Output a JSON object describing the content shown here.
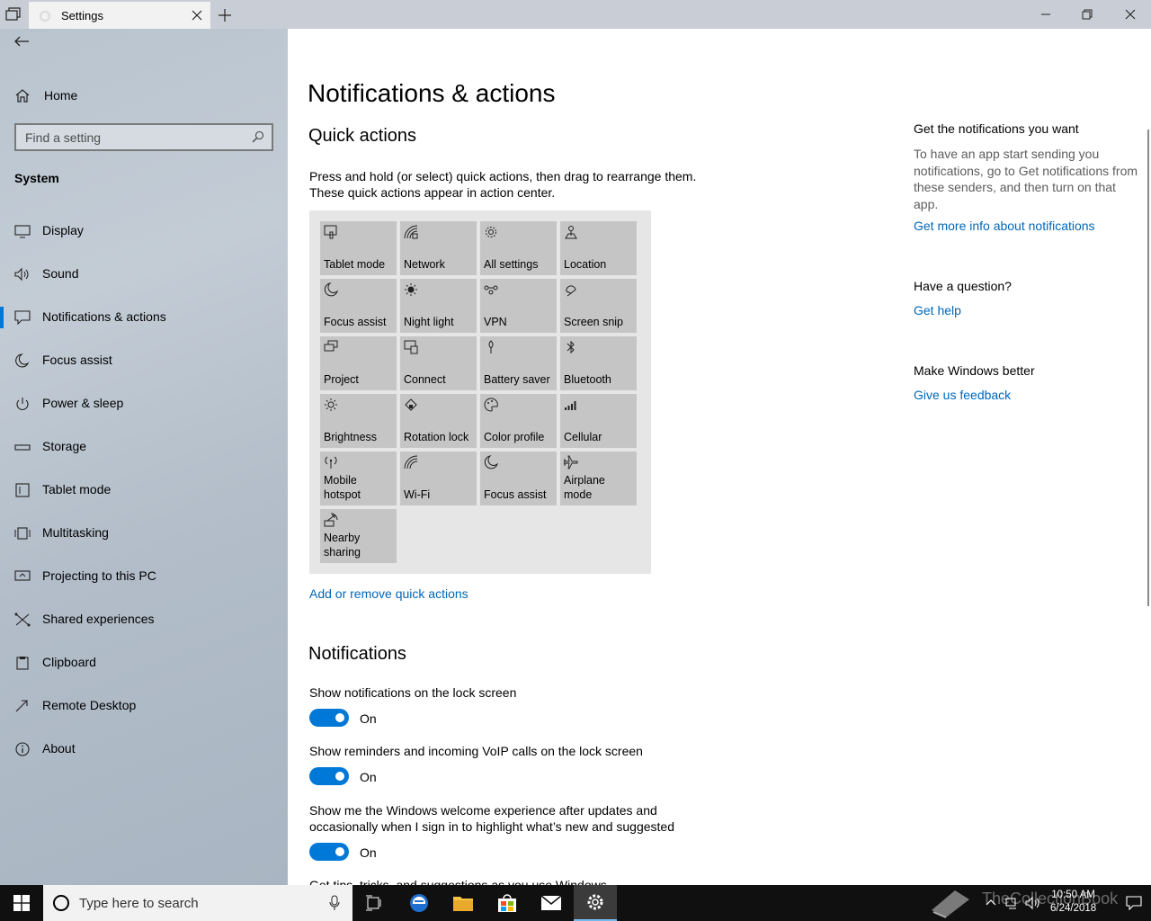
{
  "window": {
    "tab_title": "Settings"
  },
  "sidebar": {
    "home_label": "Home",
    "search_placeholder": "Find a setting",
    "section": "System",
    "items": [
      {
        "label": "Display",
        "icon": "display-icon"
      },
      {
        "label": "Sound",
        "icon": "sound-icon"
      },
      {
        "label": "Notifications & actions",
        "icon": "notification-icon",
        "selected": true
      },
      {
        "label": "Focus assist",
        "icon": "moon-icon"
      },
      {
        "label": "Power & sleep",
        "icon": "power-icon"
      },
      {
        "label": "Storage",
        "icon": "storage-icon"
      },
      {
        "label": "Tablet mode",
        "icon": "tablet-icon"
      },
      {
        "label": "Multitasking",
        "icon": "multitasking-icon"
      },
      {
        "label": "Projecting to this PC",
        "icon": "projecting-icon"
      },
      {
        "label": "Shared experiences",
        "icon": "shared-icon"
      },
      {
        "label": "Clipboard",
        "icon": "clipboard-icon"
      },
      {
        "label": "Remote Desktop",
        "icon": "remote-desktop-icon"
      },
      {
        "label": "About",
        "icon": "info-icon"
      }
    ]
  },
  "main": {
    "title": "Notifications & actions",
    "quick_actions": {
      "heading": "Quick actions",
      "description": "Press and hold (or select) quick actions, then drag to rearrange them. These quick actions appear in action center.",
      "tiles": [
        {
          "label": "Tablet mode",
          "icon": "tablet-mode-icon"
        },
        {
          "label": "Network",
          "icon": "network-icon"
        },
        {
          "label": "All settings",
          "icon": "gear-icon"
        },
        {
          "label": "Location",
          "icon": "location-icon"
        },
        {
          "label": "Focus assist",
          "icon": "moon-icon"
        },
        {
          "label": "Night light",
          "icon": "night-light-icon"
        },
        {
          "label": "VPN",
          "icon": "vpn-icon"
        },
        {
          "label": "Screen snip",
          "icon": "screen-snip-icon"
        },
        {
          "label": "Project",
          "icon": "project-icon"
        },
        {
          "label": "Connect",
          "icon": "connect-icon"
        },
        {
          "label": "Battery saver",
          "icon": "battery-saver-icon"
        },
        {
          "label": "Bluetooth",
          "icon": "bluetooth-icon"
        },
        {
          "label": "Brightness",
          "icon": "brightness-icon"
        },
        {
          "label": "Rotation lock",
          "icon": "rotation-lock-icon"
        },
        {
          "label": "Color profile",
          "icon": "color-profile-icon"
        },
        {
          "label": "Cellular",
          "icon": "cellular-icon"
        },
        {
          "label": "Mobile hotspot",
          "icon": "mobile-hotspot-icon"
        },
        {
          "label": "Wi-Fi",
          "icon": "wifi-icon"
        },
        {
          "label": "Focus assist",
          "icon": "moon-icon"
        },
        {
          "label": "Airplane mode",
          "icon": "airplane-icon"
        },
        {
          "label": "Nearby sharing",
          "icon": "nearby-sharing-icon"
        }
      ],
      "add_remove_link": "Add or remove quick actions"
    },
    "notifications": {
      "heading": "Notifications",
      "settings": [
        {
          "label": "Show notifications on the lock screen",
          "state": "On"
        },
        {
          "label": "Show reminders and incoming VoIP calls on the lock screen",
          "state": "On"
        },
        {
          "label": "Show me the Windows welcome experience after updates and occasionally when I sign in to highlight what’s new and suggested",
          "state": "On"
        },
        {
          "label": "Get tips, tricks, and suggestions as you use Windows"
        }
      ]
    }
  },
  "right_column": {
    "notif_head": "Get the notifications you want",
    "notif_text": "To have an app start sending you notifications, go to Get notifications from these senders, and then turn on that app.",
    "notif_link": "Get more info about notifications",
    "question_head": "Have a question?",
    "help_link": "Get help",
    "better_head": "Make Windows better",
    "feedback_link": "Give us feedback"
  },
  "taskbar": {
    "search_placeholder": "Type here to search",
    "watermark": "TheCollectionBook",
    "time": "10:50 AM",
    "date": "6/24/2018"
  },
  "colors": {
    "accent": "#0078d7",
    "link": "#0067b8",
    "tile": "#c5c5c5"
  }
}
